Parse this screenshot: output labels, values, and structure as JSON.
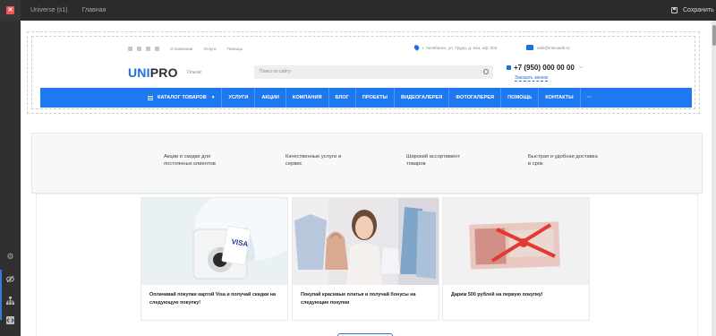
{
  "editor": {
    "brand_icon": "app-logo-icon",
    "tabs": [
      "Universe (s1)",
      "Главная"
    ],
    "save_label": "Сохранить"
  },
  "rail": {
    "icons": [
      "gear-icon",
      "eye-off-icon",
      "sitemap-icon",
      "code-icon"
    ]
  },
  "site": {
    "utility": {
      "social_icons": [
        "vk-icon",
        "instagram-icon",
        "facebook-icon",
        "twitter-icon"
      ],
      "links": [
        "О компании",
        "Услуги",
        "Помощь"
      ],
      "address": "г. Челябинск, ул. Труда, д. 64а, оф. 203",
      "email": "sale@intecweb.ru"
    },
    "logo": {
      "part1": "UNI",
      "part2": "PRO"
    },
    "city": "Ольгас",
    "search_placeholder": "Поиск по сайту",
    "phone": "+7 (950) 000 00 00",
    "callback": "Заказать звонок",
    "nav": [
      "Каталог товаров",
      "Услуги",
      "Акции",
      "Компания",
      "Блог",
      "Проекты",
      "Видеогалерея",
      "Фотогалерея",
      "Помощь",
      "Контакты",
      "···"
    ],
    "nav_color": "#1e78f0",
    "features": [
      "Акции и скидки для постоянных клиентов",
      "Качественные услуги и сервис",
      "Широкий ассортимент товаров",
      "Быстрая и удобная доставка в срок"
    ],
    "cards": [
      {
        "text": "Оплачивай покупки картой Visa и получай скидки на следующую покупку!",
        "card_label": "VISA"
      },
      {
        "text": "Покупай красивые платья и получай бонусы на следующие покупки"
      },
      {
        "text": "Дарим 500 рублей на первую покупку!"
      }
    ]
  }
}
